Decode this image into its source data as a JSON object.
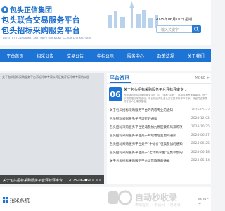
{
  "header": {
    "brand": "包头正信集团",
    "title_line1": "包头联合交易服务平台",
    "title_line2": "包头招标采购服务平台",
    "subtitle": "BAOTOU TENDERING AND PROCUREMENT SERVICE PLATFORM",
    "date": "2025年06月10日 星期二",
    "search_placeholder": "输入关键字"
  },
  "nav": {
    "items": [
      "平台首页",
      "招采公告",
      "交易公告",
      "中标公示",
      "服务中心",
      "政策法规",
      "关于我们"
    ]
  },
  "slider": {
    "top_caption": "关于包头招标采购服务平台诉讼评审专家公开征集评标评审专家的公告",
    "caption": "关于包头招标采购服务平台评标评审专...",
    "date": "2025-06-06",
    "dots": 5
  },
  "news": {
    "title": "平台资讯",
    "more": "MORE +",
    "featured": {
      "day": "06",
      "title": "关于包头招标采购服务平台评标评审专...",
      "desc": "为加强包头招标采购服务平台（以下简称“平台”）评标评审专家库建设，进一步规范招标采购活动，平台现面向社会公开征集评标评审专家，欢迎符合条件的专业人士踊跃报名。"
    },
    "items": [
      {
        "title": "关于包头招标采购服务平台的内容专业的通知",
        "date": "2025-05-22"
      },
      {
        "title": "包头招标采购服务平台运行的通知",
        "date": "2024-12-02"
      },
      {
        "title": "包头招标采购服务平台受邀参加九原区教育局采购项目交流会",
        "date": "2024-10-25"
      },
      {
        "title": "包头招标采购服务平台关于网站地址变更的通知",
        "date": "2024-06-27"
      },
      {
        "title": "包头招标采购服务平台关于“中标价”征集参加的通知",
        "date": "2024-06-25"
      },
      {
        "title": "包头招标采购服务平台关于“七年级学生”征集参加的通知",
        "date": "2024-06-18"
      },
      {
        "title": "关于包头招标采购服务平台运营情况的通知",
        "date": "2024-05-14"
      }
    ]
  },
  "zhaocai": {
    "title": "招采系统",
    "more": "MORE +"
  },
  "watermark": {
    "main": "自动秒收录",
    "sub": "表单提交 → 未访问 → 已收录"
  },
  "colors": {
    "primary": "#1d74d4",
    "title": "#1e6fcc"
  }
}
